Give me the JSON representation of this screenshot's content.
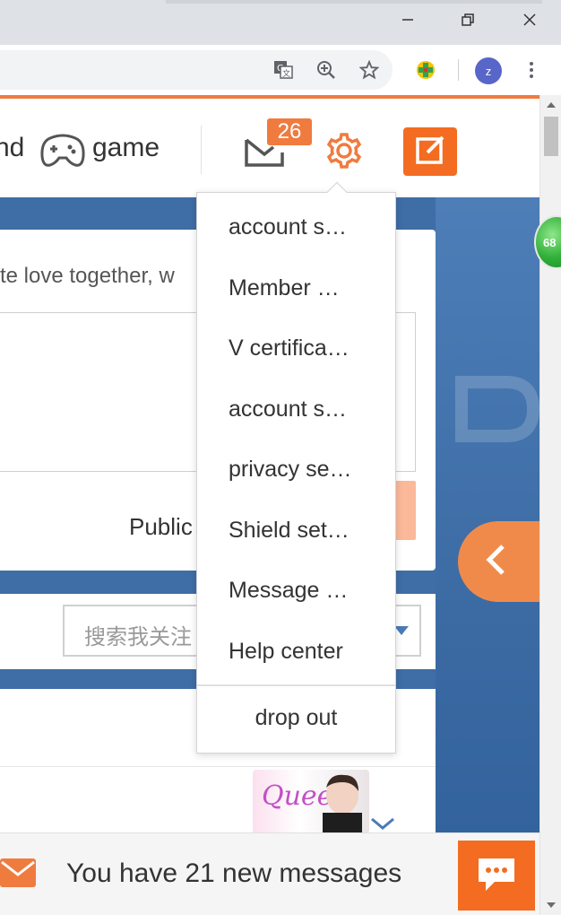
{
  "browser": {
    "profile_initial": "z"
  },
  "nav": {
    "partial_item": "nd",
    "game_label": "game",
    "messages_badge": "26"
  },
  "composer": {
    "prompt_text": "te love together, w",
    "public_label": "Public"
  },
  "follow_search": {
    "placeholder": "搜索我关注"
  },
  "sticker": {
    "text": "Queen"
  },
  "dropdown": {
    "items": [
      "account s…",
      "Member …",
      "V certifica…",
      "account s…",
      "privacy se…",
      "Shield set…",
      "Message …",
      "Help center"
    ],
    "logout": "drop out"
  },
  "notification": {
    "text": "You have 21 new messages"
  },
  "floating_widget": {
    "value": "68"
  },
  "colors": {
    "accent_orange": "#f36c21",
    "page_blue": "#3f6da5"
  }
}
